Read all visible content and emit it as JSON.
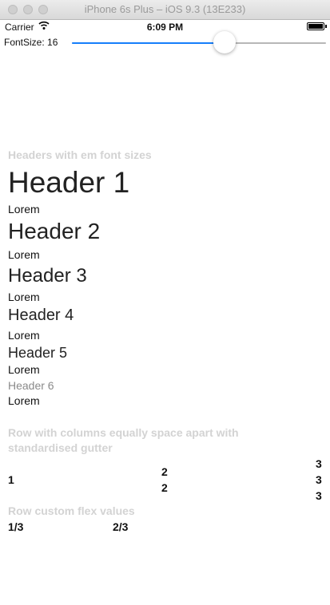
{
  "window": {
    "title": "iPhone 6s Plus – iOS 9.3 (13E233)"
  },
  "status_bar": {
    "carrier": "Carrier",
    "time": "6:09 PM"
  },
  "font_size_control": {
    "label": "FontSize: 16",
    "slider_value_fraction": 0.6
  },
  "headers_section": {
    "title": "Headers with em font sizes",
    "items": [
      {
        "header": "Header 1",
        "body": "Lorem"
      },
      {
        "header": "Header 2",
        "body": "Lorem"
      },
      {
        "header": "Header 3",
        "body": "Lorem"
      },
      {
        "header": "Header 4",
        "body": "Lorem"
      },
      {
        "header": "Header 5",
        "body": "Lorem"
      },
      {
        "header": "Header 6",
        "body": "Lorem"
      }
    ]
  },
  "gutter_section": {
    "title_line1": "Row with columns equally space apart with",
    "title_line2": "standardised gutter",
    "col1": [
      "1"
    ],
    "col2": [
      "2",
      "2"
    ],
    "col3": [
      "3",
      "3",
      "3"
    ]
  },
  "flex_section": {
    "title": "Row custom flex values",
    "col_a": "1/3",
    "col_b": "2/3"
  },
  "colors": {
    "accent": "#157efb",
    "section_title": "#d3d3d3"
  }
}
